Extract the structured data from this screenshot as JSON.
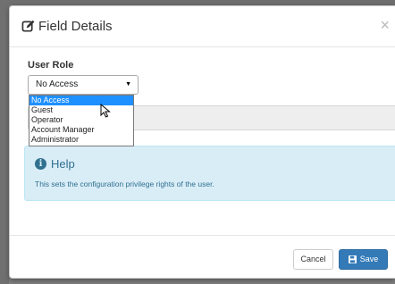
{
  "modal": {
    "title": "Field Details",
    "close_symbol": "×"
  },
  "user_role": {
    "label": "User Role",
    "selected": "No Access",
    "arrow": "▼",
    "options": [
      "No Access",
      "Guest",
      "Operator",
      "Account Manager",
      "Administrator"
    ]
  },
  "help": {
    "title": "Help",
    "icon_glyph": "i",
    "text": "This sets the configuration privilege rights of the user."
  },
  "footer": {
    "cancel_label": "Cancel",
    "save_label": "Save"
  },
  "colors": {
    "primary": "#337ab7",
    "info_bg": "#d9edf7",
    "info_text": "#31708f",
    "option_highlight": "#1e90ff"
  },
  "icons": [
    "edit-icon",
    "close-icon",
    "info-icon",
    "save-icon",
    "mouse-cursor-icon"
  ]
}
